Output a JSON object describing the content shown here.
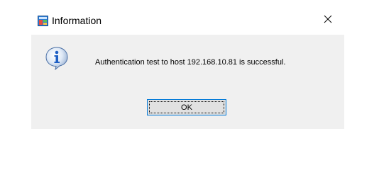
{
  "window": {
    "title": "Information",
    "icon": "app-icon",
    "close_icon": "close-icon"
  },
  "content": {
    "icon": "info-icon",
    "message": "Authentication test to host 192.168.10.81 is successful."
  },
  "buttons": {
    "ok_label": "OK"
  },
  "colors": {
    "dialog_bg": "#f0f0f0",
    "titlebar_bg": "#ffffff",
    "button_border": "#0078d7",
    "info_blue": "#1e5fc4"
  }
}
